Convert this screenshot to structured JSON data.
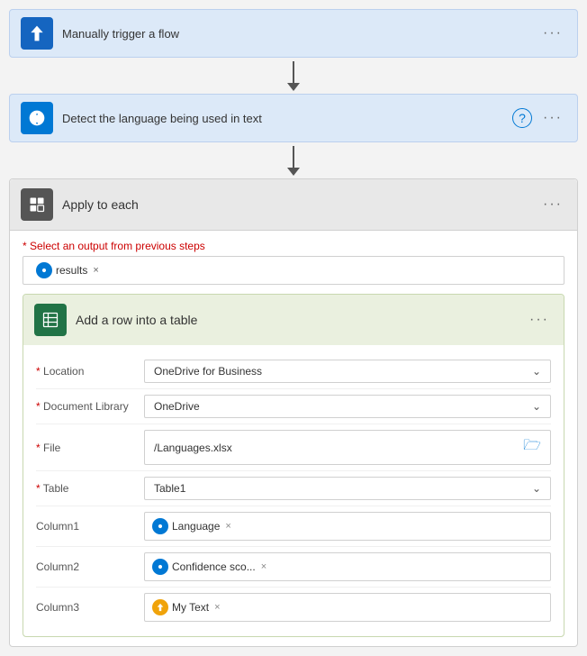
{
  "cards": {
    "trigger": {
      "title": "Manually trigger a flow"
    },
    "detect": {
      "title": "Detect the language being used in text"
    },
    "applyEach": {
      "title": "Apply to each",
      "selectOutputLabel": "* Select an output from previous steps",
      "tag": "results"
    },
    "addRow": {
      "title": "Add a row into a table",
      "fields": {
        "location": {
          "label": "Location",
          "value": "OneDrive for Business"
        },
        "docLibrary": {
          "label": "Document Library",
          "value": "OneDrive"
        },
        "file": {
          "label": "File",
          "value": "/Languages.xlsx"
        },
        "table": {
          "label": "Table",
          "value": "Table1"
        },
        "column1": {
          "label": "Column1",
          "tag": "Language"
        },
        "column2": {
          "label": "Column2",
          "tag": "Confidence sco..."
        },
        "column3": {
          "label": "Column3",
          "tag": "My Text"
        }
      }
    }
  },
  "icons": {
    "dots": "···",
    "chevronDown": "∨",
    "close": "×",
    "help": "?"
  }
}
